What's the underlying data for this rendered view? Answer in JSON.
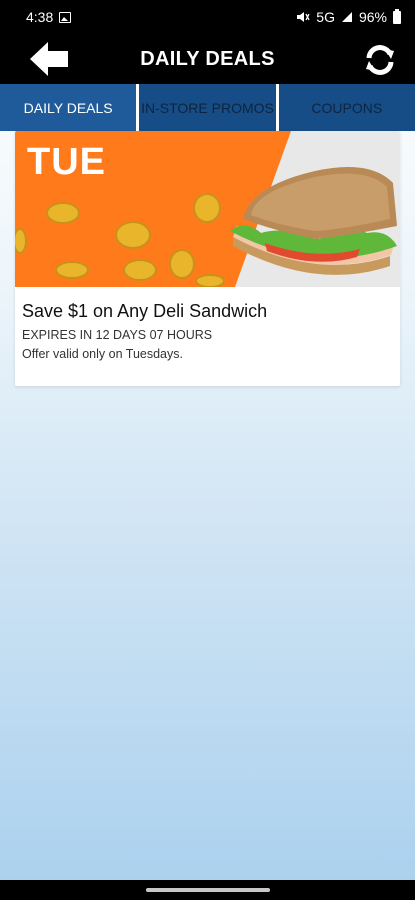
{
  "status_bar": {
    "time": "4:38",
    "network": "5G",
    "battery": "96%",
    "icons": [
      "gallery-icon",
      "mute-icon",
      "signal-icon",
      "battery-icon"
    ]
  },
  "header": {
    "title": "DAILY DEALS",
    "back_icon": "back-arrow-icon",
    "refresh_icon": "refresh-icon"
  },
  "tabs": [
    {
      "label": "DAILY DEALS",
      "active": true
    },
    {
      "label": "IN-STORE PROMOS",
      "active": false
    },
    {
      "label": "COUPONS",
      "active": false
    }
  ],
  "deal": {
    "day": "TUE",
    "title": "Save $1 on Any Deli Sandwich",
    "expiry": "EXPIRES IN 12 DAYS 07 HOURS",
    "note": "Offer valid only on Tuesdays.",
    "image": "deli-sandwich-coins-banner"
  },
  "colors": {
    "header_bg": "#000000",
    "tab_bg": "#1f5b9a",
    "banner_orange": "#ff7a1a",
    "banner_gray": "#e8e8e8",
    "coin_gold": "#e9b52a"
  }
}
